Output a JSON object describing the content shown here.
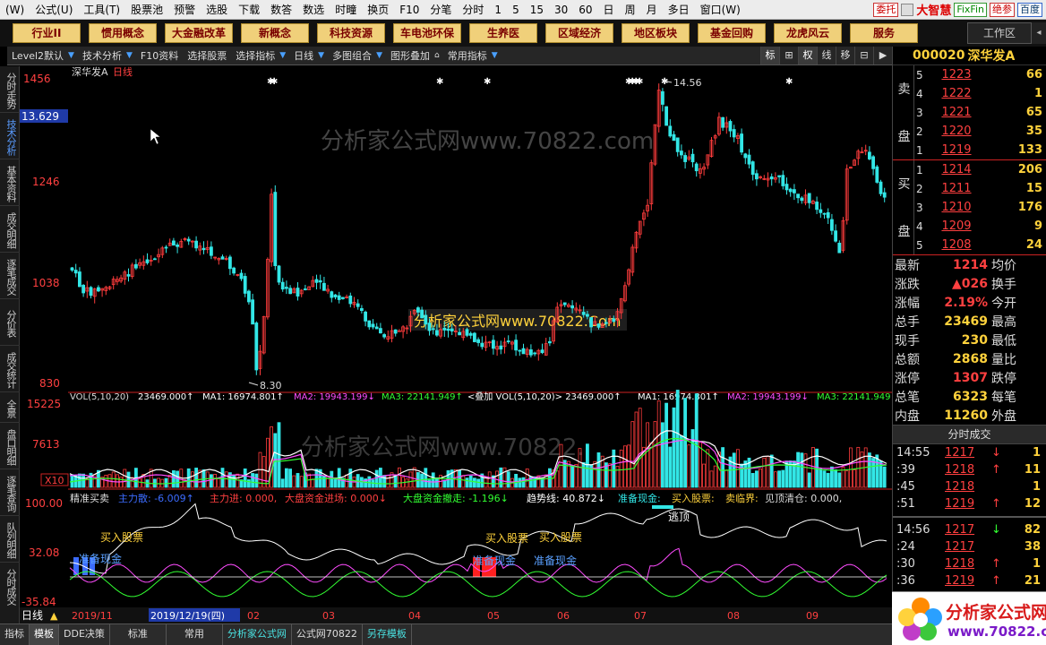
{
  "menu": {
    "items": [
      "(W)",
      "公式(U)",
      "工具(T)",
      "股票池",
      "预警",
      "选股",
      "下载",
      "数答",
      "数选",
      "时疃",
      "换页",
      "F10",
      "分笔",
      "分时",
      "1",
      "5",
      "15",
      "30",
      "60",
      "日",
      "周",
      "月",
      "多日",
      "窗口(W)"
    ],
    "right_buttons": [
      "委托",
      "大智慧",
      "FixFin",
      "绝参",
      "百度"
    ]
  },
  "sectors": [
    "行业II",
    "惯用概念",
    "大金融改革",
    "新概念",
    "科技资源",
    "车电池环保",
    "生养医",
    "区域经济",
    "地区板块",
    "基金回购",
    "龙虎风云",
    "服务"
  ],
  "workspace_label": "工作区",
  "toolbar": {
    "items": [
      "Level2默认",
      "技术分析",
      "F10资料",
      "选择股票",
      "选择指标",
      "日线",
      "多图组合",
      "图形叠加",
      "常用指标"
    ],
    "right": [
      "标",
      "⊞",
      "权",
      "线",
      "移",
      "⊟",
      "▶"
    ]
  },
  "leftbar": [
    "分时走势",
    "技术分析",
    "基本资料",
    "成交明细",
    "逐笔成交",
    "分价表",
    "成交统计",
    "全景",
    "盘口明细",
    "逐笔查询",
    "队列明细",
    "分时成交"
  ],
  "chart": {
    "title": "深华发A",
    "period": "日线",
    "price_axis": [
      "1456",
      "13.629",
      "1246",
      "1038",
      "830"
    ],
    "high_label": "14.56",
    "low_label": "8.30",
    "vol_axis": [
      "15225",
      "7613",
      "X10"
    ],
    "vol_legend": {
      "head": "VOL(5,10,20)",
      "vol": "23469.000↑",
      "ma1": "MA1: 16974.801↑",
      "ma2": "MA2: 19943.199↓",
      "ma3": "MA3: 22141.949↑",
      "overlay": "<叠加 VOL(5,10,20)> 23469.000↑",
      "ma1b": "MA1: 16974.801↑",
      "ma2b": "MA2: 19943.199↓",
      "ma3b": "MA3: 22141.949"
    },
    "ind_axis": [
      "100.00",
      "32.08",
      "-35.84"
    ],
    "ind_legend": {
      "name": "精准买卖",
      "a": "主力散: -6.009↑",
      "b": "主力进: 0.000,",
      "c": "大盘资金进场: 0.000↓",
      "d": "大盘资金撤走: -1.196↓",
      "e": "趋势线: 40.872↓",
      "f": "准备现金:",
      "g": "买入股票:",
      "h": "卖临界:",
      "i": "见顶清仓: 0.000,"
    },
    "ind_labels": {
      "buy": "买入股票",
      "cash": "准备现金",
      "top": "逃顶"
    },
    "x_labels": [
      "2019/11",
      "2019/12/19(四)",
      "02",
      "03",
      "04",
      "05",
      "06",
      "07",
      "08",
      "09"
    ],
    "bottom_left": "日线",
    "watermark_top": "分析家公式网www.70822.com",
    "watermark_mid": "分析家公式网www.70822.Com",
    "watermark_vol": "分析家公式网www.70822."
  },
  "bottom_tabs": [
    "指标",
    "模板",
    "DDE决策",
    "标准",
    "常用",
    "分析家公式网",
    "公式网70822",
    "另存模板"
  ],
  "right_panel": {
    "code": "000020",
    "name": "深华发A",
    "sell_label": [
      "卖",
      "盘"
    ],
    "buy_label": [
      "买",
      "盘"
    ],
    "asks": [
      {
        "lv": "5",
        "price": "1223",
        "vol": "66"
      },
      {
        "lv": "4",
        "price": "1222",
        "vol": "1"
      },
      {
        "lv": "3",
        "price": "1221",
        "vol": "65"
      },
      {
        "lv": "2",
        "price": "1220",
        "vol": "35"
      },
      {
        "lv": "1",
        "price": "1219",
        "vol": "133"
      }
    ],
    "bids": [
      {
        "lv": "1",
        "price": "1214",
        "vol": "206"
      },
      {
        "lv": "2",
        "price": "1211",
        "vol": "15"
      },
      {
        "lv": "3",
        "price": "1210",
        "vol": "176"
      },
      {
        "lv": "4",
        "price": "1209",
        "vol": "9"
      },
      {
        "lv": "5",
        "price": "1208",
        "vol": "24"
      }
    ],
    "stats": [
      {
        "k": "最新",
        "v": "1214",
        "k2": "均价"
      },
      {
        "k": "涨跌",
        "v": "▲026",
        "k2": "换手"
      },
      {
        "k": "涨幅",
        "v": "2.19%",
        "k2": "今开"
      },
      {
        "k": "总手",
        "v": "23469",
        "k2": "最高"
      },
      {
        "k": "现手",
        "v": "230",
        "k2": "最低"
      },
      {
        "k": "总额",
        "v": "2868",
        "k2": "量比"
      },
      {
        "k": "涨停",
        "v": "1307",
        "k2": "跌停"
      },
      {
        "k": "总笔",
        "v": "6323",
        "k2": "每笔"
      },
      {
        "k": "内盘",
        "v": "11260",
        "k2": "外盘"
      }
    ],
    "tick_title": "分时成交",
    "ticks_a": [
      {
        "t": "14:55",
        "p": "1217",
        "ar": "↓",
        "v": "1"
      },
      {
        "t": ":39",
        "p": "1218",
        "ar": "↑",
        "v": "11"
      },
      {
        "t": ":45",
        "p": "1218",
        "ar": "",
        "v": "1"
      },
      {
        "t": ":51",
        "p": "1219",
        "ar": "↑",
        "v": "12"
      }
    ],
    "ticks_b": [
      {
        "t": "14:56",
        "p": "1217",
        "ar": "↓",
        "v": "82"
      },
      {
        "t": ":24",
        "p": "1217",
        "ar": "",
        "v": "38"
      },
      {
        "t": ":30",
        "p": "1218",
        "ar": "↑",
        "v": "1"
      },
      {
        "t": ":36",
        "p": "1219",
        "ar": "↑",
        "v": "21"
      }
    ]
  },
  "logo": {
    "line1": "分析家公式网",
    "line2": "www.70822.com"
  },
  "colors": {
    "up": "#ff3c3c",
    "down": "#32e6e6",
    "price_text": "#ff4040",
    "accent_yellow": "#ffd23c",
    "ma1": "#ffffff",
    "ma2": "#ffd23c",
    "ma3": "#ff4cff"
  }
}
